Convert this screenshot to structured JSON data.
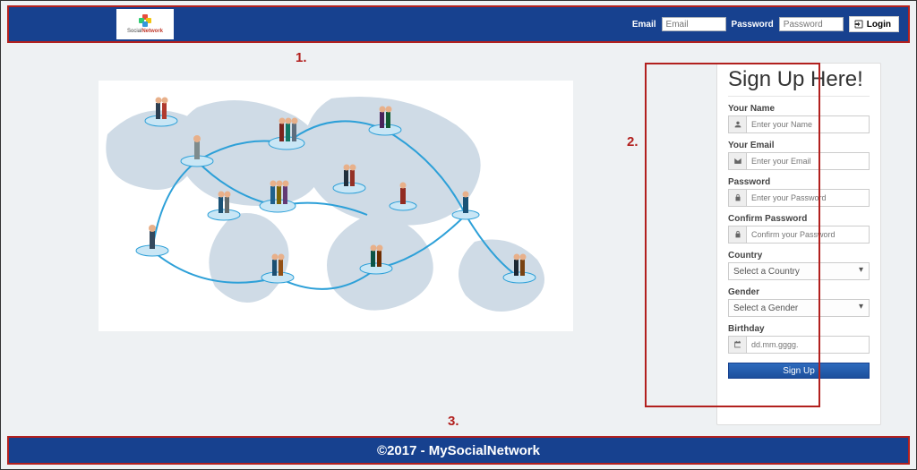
{
  "header": {
    "logo_text_plain": "Social",
    "logo_text_bold": "Network",
    "email_label": "Email",
    "email_placeholder": "Email",
    "password_label": "Password",
    "password_placeholder": "Password",
    "login_label": "Login"
  },
  "annotations": {
    "one": "1.",
    "two": "2.",
    "three": "3."
  },
  "signup": {
    "title": "Sign Up Here!",
    "name_label": "Your Name",
    "name_placeholder": "Enter your Name",
    "email_label": "Your Email",
    "email_placeholder": "Enter your Email",
    "password_label": "Password",
    "password_placeholder": "Enter your Password",
    "confirm_label": "Confirm Password",
    "confirm_placeholder": "Confirm your Password",
    "country_label": "Country",
    "country_selected": "Select a Country",
    "gender_label": "Gender",
    "gender_selected": "Select a Gender",
    "birthday_label": "Birthday",
    "birthday_placeholder": "dd.mm.gggg.",
    "submit_label": "Sign Up"
  },
  "footer": {
    "text": "©2017 - MySocialNetwork"
  }
}
